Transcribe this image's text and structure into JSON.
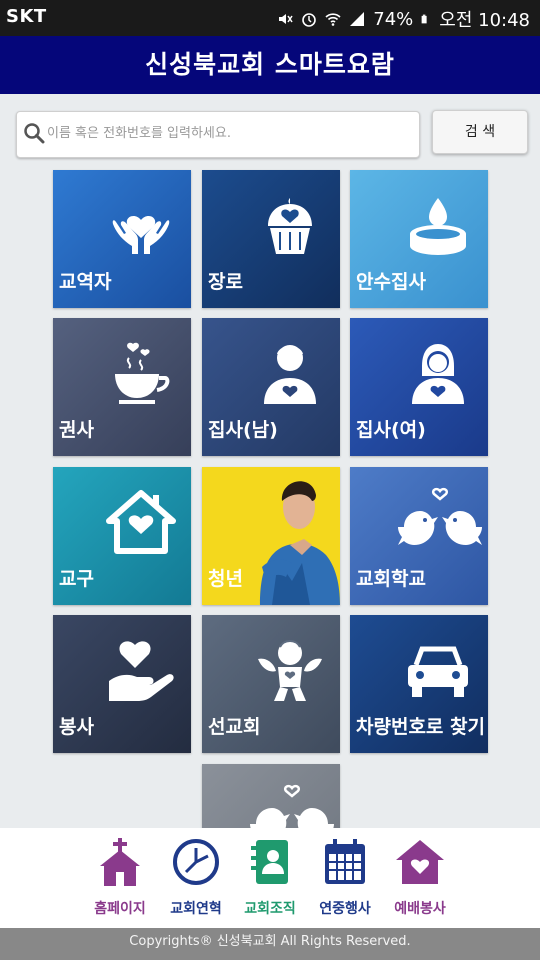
{
  "status_bar": {
    "carrier": "SKT",
    "battery": "74%",
    "time": "오전 10:48"
  },
  "app": {
    "title": "신성북교회 스마트요람"
  },
  "search": {
    "placeholder": "이름 혹은 전화번호를 입력하세요.",
    "button_label": "검 색"
  },
  "tiles": [
    {
      "label": "교역자",
      "icon": "hands-heart-icon",
      "color": "#1f5eb4"
    },
    {
      "label": "장로",
      "icon": "cupcake-heart-icon",
      "color": "#153d74"
    },
    {
      "label": "안수집사",
      "icon": "candle-icon",
      "color": "#4aa6db"
    },
    {
      "label": "권사",
      "icon": "teacup-heart-icon",
      "color": "#414e6e"
    },
    {
      "label": "집사(남)",
      "icon": "man-heart-icon",
      "color": "#2b4479"
    },
    {
      "label": "집사(여)",
      "icon": "woman-heart-icon",
      "color": "#2148a0"
    },
    {
      "label": "교구",
      "icon": "house-heart-icon",
      "color": "#1d8fa9"
    },
    {
      "label": "청년",
      "icon": "young-man-photo",
      "color": "#f2d61c"
    },
    {
      "label": "교회학교",
      "icon": "lovebirds-icon",
      "color": "#3a67b7"
    },
    {
      "label": "봉사",
      "icon": "hand-heart-icon",
      "color": "#2c3a54"
    },
    {
      "label": "선교회",
      "icon": "cupid-icon",
      "color": "#4f5d70"
    },
    {
      "label": "차량번호로 찾기",
      "icon": "car-icon",
      "color": "#173a76"
    },
    {
      "label": "",
      "icon": "lovebirds-icon",
      "color": "#7d848e"
    }
  ],
  "bottom_nav": [
    {
      "label": "홈페이지",
      "icon": "church-icon",
      "color": "#8a3a8c"
    },
    {
      "label": "교회연혁",
      "icon": "clock-icon",
      "color": "#1f3a8a"
    },
    {
      "label": "교회조직",
      "icon": "contacts-book-icon",
      "color": "#1f9a6e"
    },
    {
      "label": "연중행사",
      "icon": "calendar-icon",
      "color": "#1f3a8a"
    },
    {
      "label": "예배봉사",
      "icon": "heart-house-icon",
      "color": "#8a3a8c"
    }
  ],
  "footer": {
    "text": "Copyrights® 신성북교회 All Rights Reserved."
  }
}
